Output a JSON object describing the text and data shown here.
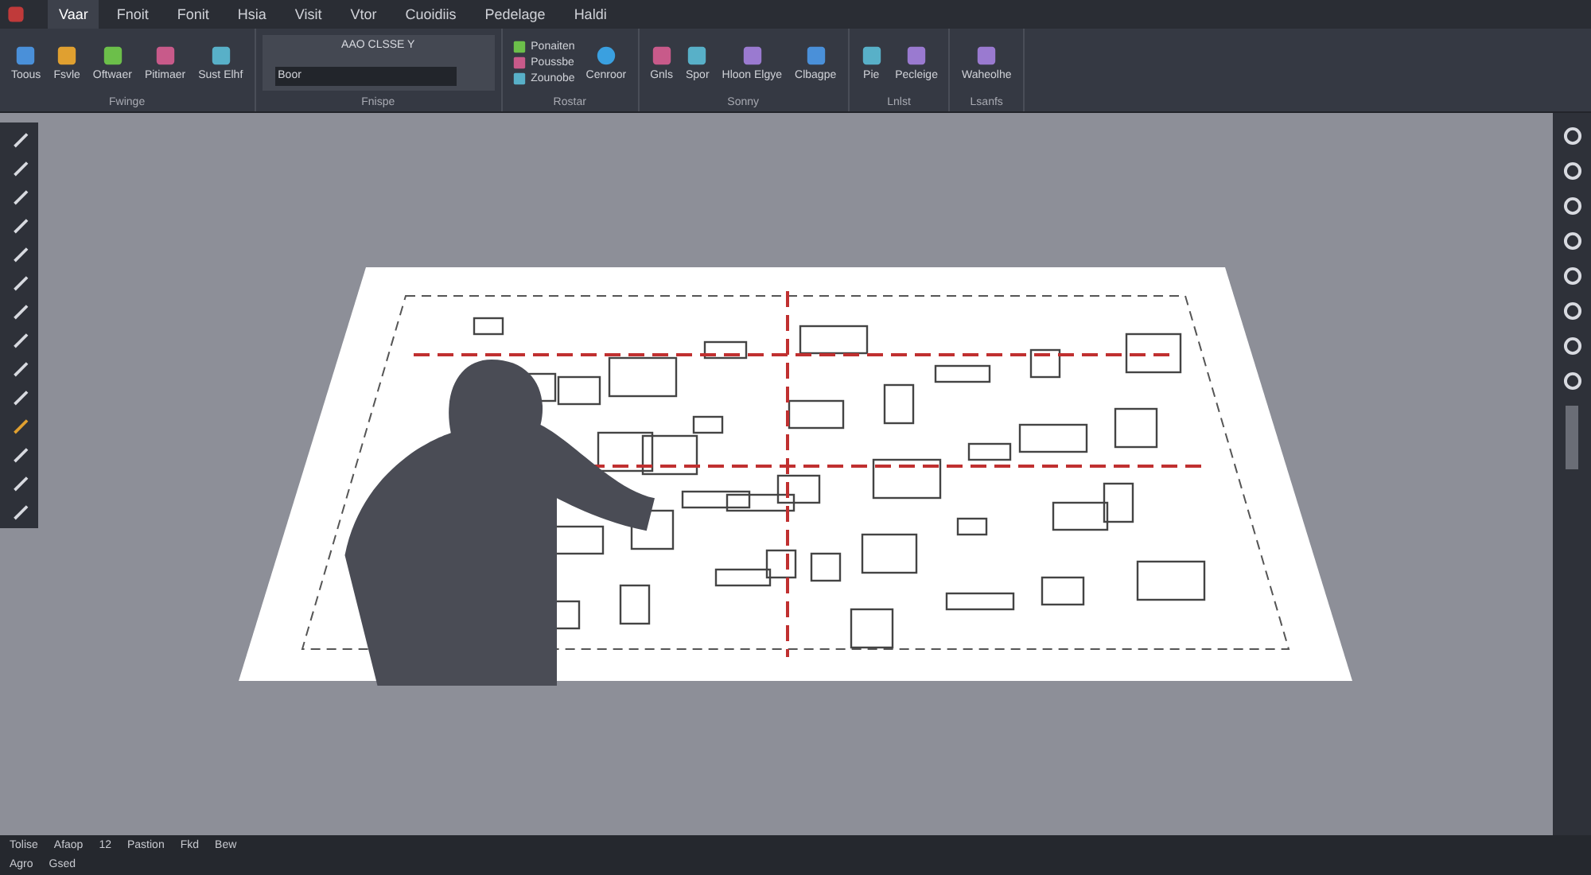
{
  "menu_tabs": [
    {
      "label": "Vaar",
      "selected": true
    },
    {
      "label": "Fnoit",
      "selected": false
    },
    {
      "label": "Fonit",
      "selected": false
    },
    {
      "label": "Hsia",
      "selected": false
    },
    {
      "label": "Visit",
      "selected": false
    },
    {
      "label": "Vtor",
      "selected": false
    },
    {
      "label": "Cuoidiis",
      "selected": false
    },
    {
      "label": "Pedelage",
      "selected": false
    },
    {
      "label": "Haldi",
      "selected": false
    }
  ],
  "ribbon_groups": [
    {
      "label": "Fwinge",
      "kind": "buttons",
      "items": [
        "Toous",
        "Fsvle",
        "Oftwaer",
        "Pitimaer",
        "Sust Elhf"
      ]
    },
    {
      "label": "Fnispe",
      "kind": "field",
      "field_title": "AAO CLSSE Y",
      "field_value": "Boor"
    },
    {
      "label": "Rostar",
      "kind": "list",
      "items": [
        "Ponaiten",
        "Poussbe",
        "Zounobe"
      ],
      "extra": "Cenroor"
    },
    {
      "label": "Sonny",
      "kind": "buttons",
      "items": [
        "Gnls",
        "Spor",
        "Hloon Elgye",
        "Clbagpe"
      ]
    },
    {
      "label": "Lnlst",
      "kind": "buttons",
      "items": [
        "Pie",
        "Pecleige"
      ]
    },
    {
      "label": "Lsanfs",
      "kind": "buttons",
      "items": [
        "Waheolhe"
      ]
    }
  ],
  "status_bar": {
    "row_1": [
      "Tolise",
      "Afaop",
      "12",
      "Pastion",
      "Fkd",
      "Bew"
    ],
    "row_2": [
      "Agro",
      "Gsed"
    ]
  }
}
